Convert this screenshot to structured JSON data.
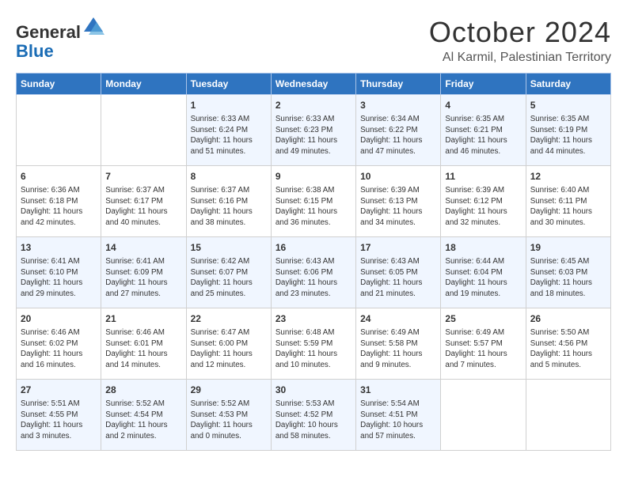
{
  "header": {
    "logo_general": "General",
    "logo_blue": "Blue",
    "month_title": "October 2024",
    "location": "Al Karmil, Palestinian Territory"
  },
  "days_of_week": [
    "Sunday",
    "Monday",
    "Tuesday",
    "Wednesday",
    "Thursday",
    "Friday",
    "Saturday"
  ],
  "weeks": [
    [
      {
        "day": "",
        "info": ""
      },
      {
        "day": "",
        "info": ""
      },
      {
        "day": "1",
        "info": "Sunrise: 6:33 AM\nSunset: 6:24 PM\nDaylight: 11 hours and 51 minutes."
      },
      {
        "day": "2",
        "info": "Sunrise: 6:33 AM\nSunset: 6:23 PM\nDaylight: 11 hours and 49 minutes."
      },
      {
        "day": "3",
        "info": "Sunrise: 6:34 AM\nSunset: 6:22 PM\nDaylight: 11 hours and 47 minutes."
      },
      {
        "day": "4",
        "info": "Sunrise: 6:35 AM\nSunset: 6:21 PM\nDaylight: 11 hours and 46 minutes."
      },
      {
        "day": "5",
        "info": "Sunrise: 6:35 AM\nSunset: 6:19 PM\nDaylight: 11 hours and 44 minutes."
      }
    ],
    [
      {
        "day": "6",
        "info": "Sunrise: 6:36 AM\nSunset: 6:18 PM\nDaylight: 11 hours and 42 minutes."
      },
      {
        "day": "7",
        "info": "Sunrise: 6:37 AM\nSunset: 6:17 PM\nDaylight: 11 hours and 40 minutes."
      },
      {
        "day": "8",
        "info": "Sunrise: 6:37 AM\nSunset: 6:16 PM\nDaylight: 11 hours and 38 minutes."
      },
      {
        "day": "9",
        "info": "Sunrise: 6:38 AM\nSunset: 6:15 PM\nDaylight: 11 hours and 36 minutes."
      },
      {
        "day": "10",
        "info": "Sunrise: 6:39 AM\nSunset: 6:13 PM\nDaylight: 11 hours and 34 minutes."
      },
      {
        "day": "11",
        "info": "Sunrise: 6:39 AM\nSunset: 6:12 PM\nDaylight: 11 hours and 32 minutes."
      },
      {
        "day": "12",
        "info": "Sunrise: 6:40 AM\nSunset: 6:11 PM\nDaylight: 11 hours and 30 minutes."
      }
    ],
    [
      {
        "day": "13",
        "info": "Sunrise: 6:41 AM\nSunset: 6:10 PM\nDaylight: 11 hours and 29 minutes."
      },
      {
        "day": "14",
        "info": "Sunrise: 6:41 AM\nSunset: 6:09 PM\nDaylight: 11 hours and 27 minutes."
      },
      {
        "day": "15",
        "info": "Sunrise: 6:42 AM\nSunset: 6:07 PM\nDaylight: 11 hours and 25 minutes."
      },
      {
        "day": "16",
        "info": "Sunrise: 6:43 AM\nSunset: 6:06 PM\nDaylight: 11 hours and 23 minutes."
      },
      {
        "day": "17",
        "info": "Sunrise: 6:43 AM\nSunset: 6:05 PM\nDaylight: 11 hours and 21 minutes."
      },
      {
        "day": "18",
        "info": "Sunrise: 6:44 AM\nSunset: 6:04 PM\nDaylight: 11 hours and 19 minutes."
      },
      {
        "day": "19",
        "info": "Sunrise: 6:45 AM\nSunset: 6:03 PM\nDaylight: 11 hours and 18 minutes."
      }
    ],
    [
      {
        "day": "20",
        "info": "Sunrise: 6:46 AM\nSunset: 6:02 PM\nDaylight: 11 hours and 16 minutes."
      },
      {
        "day": "21",
        "info": "Sunrise: 6:46 AM\nSunset: 6:01 PM\nDaylight: 11 hours and 14 minutes."
      },
      {
        "day": "22",
        "info": "Sunrise: 6:47 AM\nSunset: 6:00 PM\nDaylight: 11 hours and 12 minutes."
      },
      {
        "day": "23",
        "info": "Sunrise: 6:48 AM\nSunset: 5:59 PM\nDaylight: 11 hours and 10 minutes."
      },
      {
        "day": "24",
        "info": "Sunrise: 6:49 AM\nSunset: 5:58 PM\nDaylight: 11 hours and 9 minutes."
      },
      {
        "day": "25",
        "info": "Sunrise: 6:49 AM\nSunset: 5:57 PM\nDaylight: 11 hours and 7 minutes."
      },
      {
        "day": "26",
        "info": "Sunrise: 5:50 AM\nSunset: 4:56 PM\nDaylight: 11 hours and 5 minutes."
      }
    ],
    [
      {
        "day": "27",
        "info": "Sunrise: 5:51 AM\nSunset: 4:55 PM\nDaylight: 11 hours and 3 minutes."
      },
      {
        "day": "28",
        "info": "Sunrise: 5:52 AM\nSunset: 4:54 PM\nDaylight: 11 hours and 2 minutes."
      },
      {
        "day": "29",
        "info": "Sunrise: 5:52 AM\nSunset: 4:53 PM\nDaylight: 11 hours and 0 minutes."
      },
      {
        "day": "30",
        "info": "Sunrise: 5:53 AM\nSunset: 4:52 PM\nDaylight: 10 hours and 58 minutes."
      },
      {
        "day": "31",
        "info": "Sunrise: 5:54 AM\nSunset: 4:51 PM\nDaylight: 10 hours and 57 minutes."
      },
      {
        "day": "",
        "info": ""
      },
      {
        "day": "",
        "info": ""
      }
    ]
  ]
}
